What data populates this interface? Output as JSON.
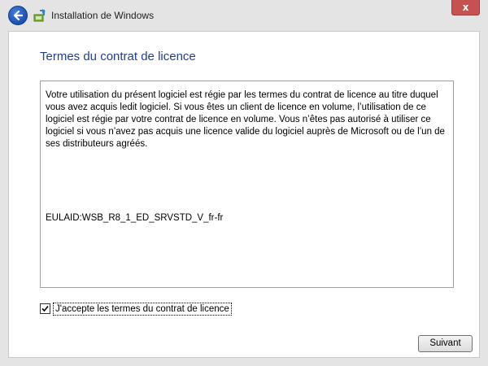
{
  "window": {
    "title": "Installation de Windows",
    "close_glyph": "x"
  },
  "icons": {
    "back": "back-arrow-icon",
    "app": "windows-setup-icon",
    "close": "close-icon",
    "check": "checkmark-icon"
  },
  "page": {
    "heading": "Termes du contrat de licence",
    "license_text": "Votre utilisation du présent logiciel est régie par les termes du contrat de licence au titre duquel vous avez acquis ledit logiciel. Si vous êtes un client de licence en volume, l’utilisation de ce logiciel est régie par votre contrat de licence en volume. Vous n’êtes pas autorisé à utiliser ce logiciel si vous n’avez pas acquis une licence valide du logiciel auprès de Microsoft ou de l’un de ses distributeurs agréés.",
    "eula_id": "EULAID:WSB_R8_1_ED_SRVSTD_V_fr-fr",
    "accept_label": "J'accepte les termes du contrat de licence",
    "accept_checked": true,
    "next_button": "Suivant"
  },
  "colors": {
    "heading": "#1f3f8f",
    "close_button": "#c75050",
    "back_button": "#1f56b8"
  }
}
